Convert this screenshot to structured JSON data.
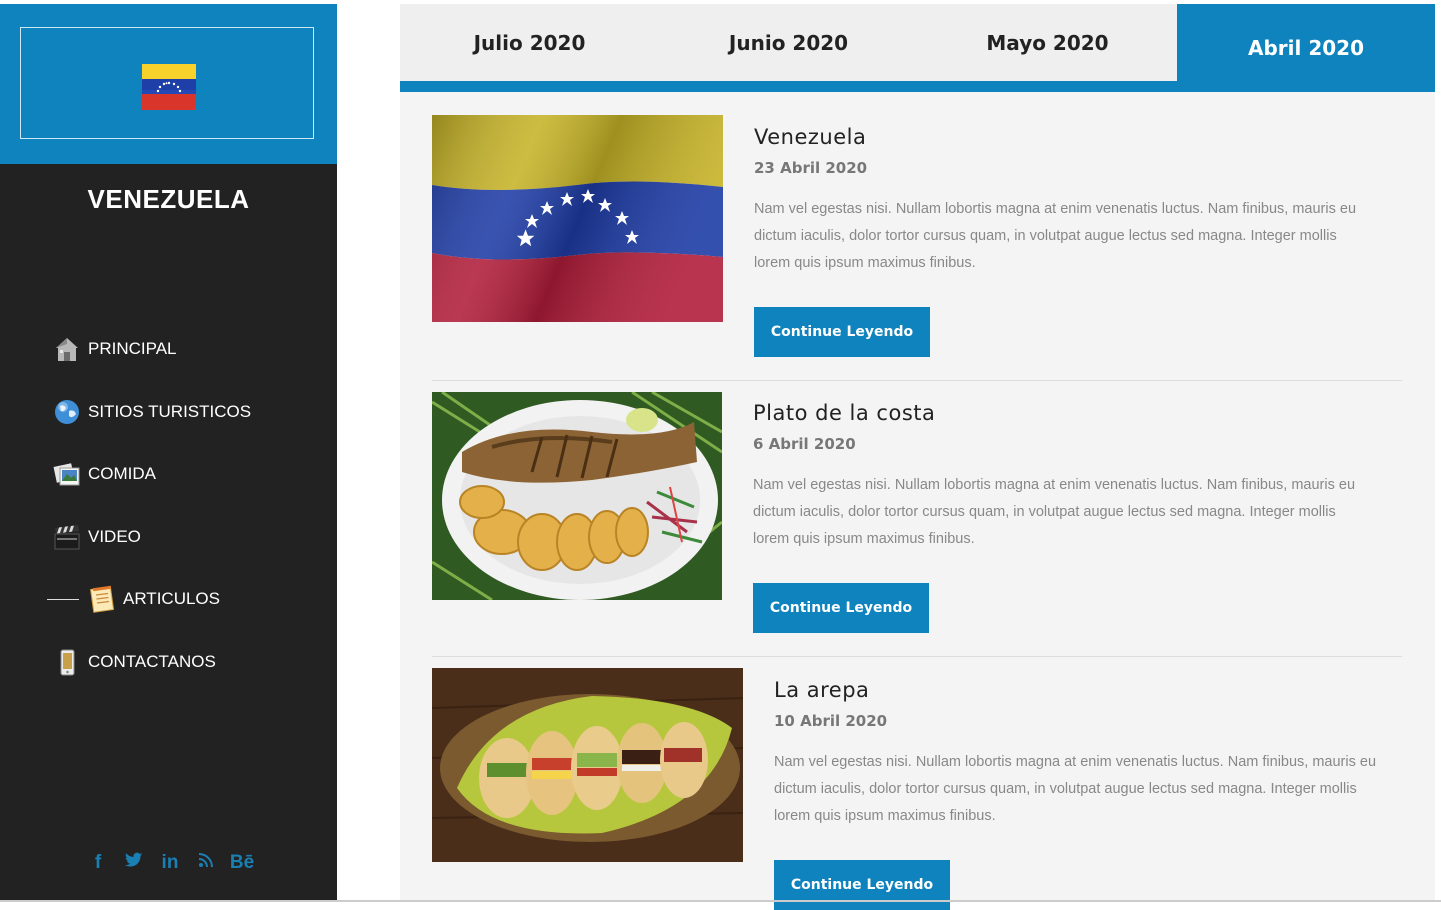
{
  "sidebar": {
    "title": "VENEZUELA",
    "nav": [
      {
        "label": "PRINCIPAL",
        "icon": "house-icon"
      },
      {
        "label": "SITIOS TURISTICOS",
        "icon": "globe-icon"
      },
      {
        "label": "COMIDA",
        "icon": "photos-icon"
      },
      {
        "label": "VIDEO",
        "icon": "clapperboard-icon"
      },
      {
        "label": "ARTICULOS",
        "icon": "notepad-icon",
        "active": true
      },
      {
        "label": "CONTACTANOS",
        "icon": "phone-icon"
      }
    ],
    "social": [
      {
        "label": "f",
        "icon": "facebook-icon"
      },
      {
        "label": "🐦",
        "icon": "twitter-icon"
      },
      {
        "label": "in",
        "icon": "linkedin-icon"
      },
      {
        "label": "⋰",
        "icon": "rss-icon"
      },
      {
        "label": "Bē",
        "icon": "behance-icon"
      }
    ]
  },
  "tabs": [
    {
      "label": "Julio 2020"
    },
    {
      "label": "Junio 2020"
    },
    {
      "label": "Mayo 2020"
    },
    {
      "label": "Abril 2020",
      "active": true
    }
  ],
  "articles": [
    {
      "title": "Venezuela",
      "date": "23 Abril 2020",
      "text": "Nam vel egestas nisi. Nullam lobortis magna at enim venenatis luctus. Nam finibus, mauris eu dictum iaculis, dolor tortor cursus quam, in volutpat augue lectus sed magna. Integer mollis lorem quis ipsum maximus finibus.",
      "button": "Continue Leyendo",
      "image": "venezuela-flag-photo"
    },
    {
      "title": "Plato de la costa",
      "date": "6 Abril 2020",
      "text": "Nam vel egestas nisi. Nullam lobortis magna at enim venenatis luctus. Nam finibus, mauris eu dictum iaculis, dolor tortor cursus quam, in volutpat augue lectus sed magna. Integer mollis lorem quis ipsum maximus finibus.",
      "button": "Continue Leyendo",
      "image": "fried-fish-plate-photo"
    },
    {
      "title": "La arepa",
      "date": "10 Abril 2020",
      "text": "Nam vel egestas nisi. Nullam lobortis magna at enim venenatis luctus. Nam finibus, mauris eu dictum iaculis, dolor tortor cursus quam, in volutpat augue lectus sed magna. Integer mollis lorem quis ipsum maximus finibus.",
      "button": "Continue Leyendo",
      "image": "arepas-basket-photo"
    }
  ],
  "colors": {
    "accent": "#0e83bd",
    "sidebar": "#222222",
    "content_bg": "#f4f4f4"
  }
}
